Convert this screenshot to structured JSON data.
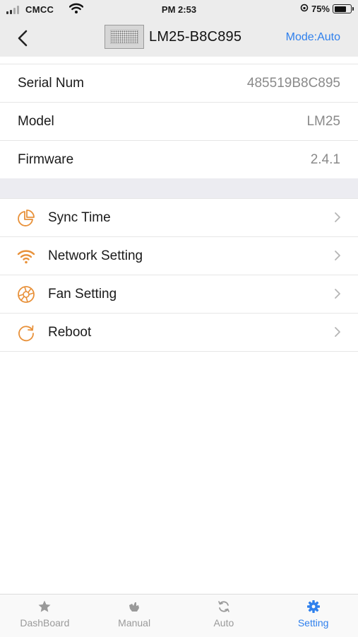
{
  "status_bar": {
    "carrier": "CMCC",
    "time": "PM 2:53",
    "battery": "75%",
    "battery_level": 0.75
  },
  "nav": {
    "title": "LM25-B8C895",
    "mode": "Mode:Auto",
    "back_icon": "chevron-left-icon"
  },
  "info": [
    {
      "label": "Serial Num",
      "value": "485519B8C895"
    },
    {
      "label": "Model",
      "value": "LM25"
    },
    {
      "label": "Firmware",
      "value": "2.4.1"
    }
  ],
  "menu": [
    {
      "label": "Sync Time",
      "icon": "pie-chart-icon"
    },
    {
      "label": "Network Setting",
      "icon": "wifi-icon"
    },
    {
      "label": "Fan Setting",
      "icon": "fan-icon"
    },
    {
      "label": "Reboot",
      "icon": "refresh-icon"
    }
  ],
  "tabs": [
    {
      "label": "DashBoard",
      "icon": "star-icon"
    },
    {
      "label": "Manual",
      "icon": "hand-icon"
    },
    {
      "label": "Auto",
      "icon": "sync-icon"
    },
    {
      "label": "Setting",
      "icon": "gear-icon"
    }
  ],
  "colors": {
    "accent": "#2f80ed",
    "icon_orange": "#e8913a",
    "nav_bg": "#ececec",
    "muted_text": "#8a8a8a"
  }
}
